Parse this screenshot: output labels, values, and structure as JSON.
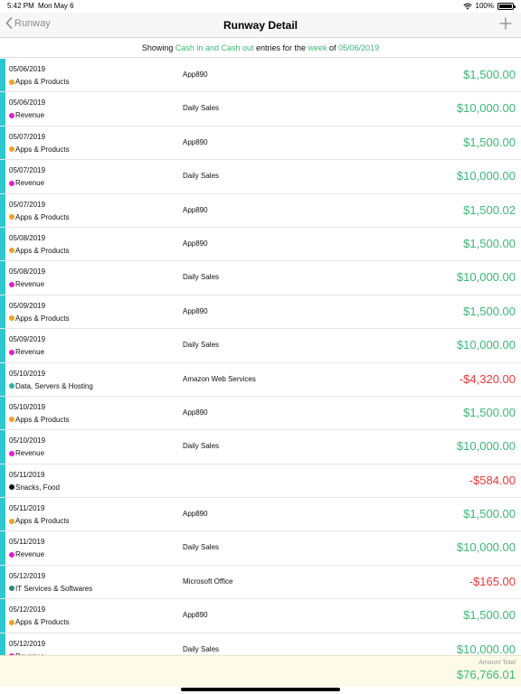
{
  "status": {
    "time": "5:42 PM",
    "date": "Mon May 6",
    "battery": "100%"
  },
  "nav": {
    "back_label": "Runway",
    "title": "Runway Detail"
  },
  "filter": {
    "prefix": "Showing ",
    "scope": "Cash in and Cash out",
    "middle": " entries for the ",
    "period": "week",
    "of": " of ",
    "date": "05/06/2019"
  },
  "colors": {
    "positive": "#3cb878",
    "negative": "#e83a3a",
    "stripe": "#2ec7cf",
    "category_dots": {
      "Apps & Products": "#f0a020",
      "Revenue": "#e020c8",
      "Data, Servers & Hosting": "#26b5a5",
      "Snacks, Food": "#111111",
      "IT Services & Softwares": "#2a8a7a"
    }
  },
  "entries": [
    {
      "date": "05/06/2019",
      "category": "Apps & Products",
      "description": "App890",
      "amount": "$1,500.00",
      "sign": "pos"
    },
    {
      "date": "05/06/2019",
      "category": "Revenue",
      "description": "Daily Sales",
      "amount": "$10,000.00",
      "sign": "pos"
    },
    {
      "date": "05/07/2019",
      "category": "Apps & Products",
      "description": "App890",
      "amount": "$1,500.00",
      "sign": "pos"
    },
    {
      "date": "05/07/2019",
      "category": "Revenue",
      "description": "Daily Sales",
      "amount": "$10,000.00",
      "sign": "pos"
    },
    {
      "date": "05/07/2019",
      "category": "Apps & Products",
      "description": "App890",
      "amount": "$1,500.02",
      "sign": "pos"
    },
    {
      "date": "05/08/2019",
      "category": "Apps & Products",
      "description": "App890",
      "amount": "$1,500.00",
      "sign": "pos"
    },
    {
      "date": "05/08/2019",
      "category": "Revenue",
      "description": "Daily Sales",
      "amount": "$10,000.00",
      "sign": "pos"
    },
    {
      "date": "05/09/2019",
      "category": "Apps & Products",
      "description": "App890",
      "amount": "$1,500.00",
      "sign": "pos"
    },
    {
      "date": "05/09/2019",
      "category": "Revenue",
      "description": "Daily Sales",
      "amount": "$10,000.00",
      "sign": "pos"
    },
    {
      "date": "05/10/2019",
      "category": "Data, Servers & Hosting",
      "description": "Amazon Web Services",
      "amount": "-$4,320.00",
      "sign": "neg"
    },
    {
      "date": "05/10/2019",
      "category": "Apps & Products",
      "description": "App890",
      "amount": "$1,500.00",
      "sign": "pos"
    },
    {
      "date": "05/10/2019",
      "category": "Revenue",
      "description": "Daily Sales",
      "amount": "$10,000.00",
      "sign": "pos"
    },
    {
      "date": "05/11/2019",
      "category": "Snacks, Food",
      "description": "",
      "amount": "-$584.00",
      "sign": "neg"
    },
    {
      "date": "05/11/2019",
      "category": "Apps & Products",
      "description": "App890",
      "amount": "$1,500.00",
      "sign": "pos"
    },
    {
      "date": "05/11/2019",
      "category": "Revenue",
      "description": "Daily Sales",
      "amount": "$10,000.00",
      "sign": "pos"
    },
    {
      "date": "05/12/2019",
      "category": "IT Services & Softwares",
      "description": "Microsoft Office",
      "amount": "-$165.00",
      "sign": "neg"
    },
    {
      "date": "05/12/2019",
      "category": "Apps & Products",
      "description": "App890",
      "amount": "$1,500.00",
      "sign": "pos"
    },
    {
      "date": "05/12/2019",
      "category": "Revenue",
      "description": "Daily Sales",
      "amount": "$10,000.00",
      "sign": "pos"
    }
  ],
  "footer": {
    "label": "Amount Total",
    "total": "$76,766.01"
  }
}
